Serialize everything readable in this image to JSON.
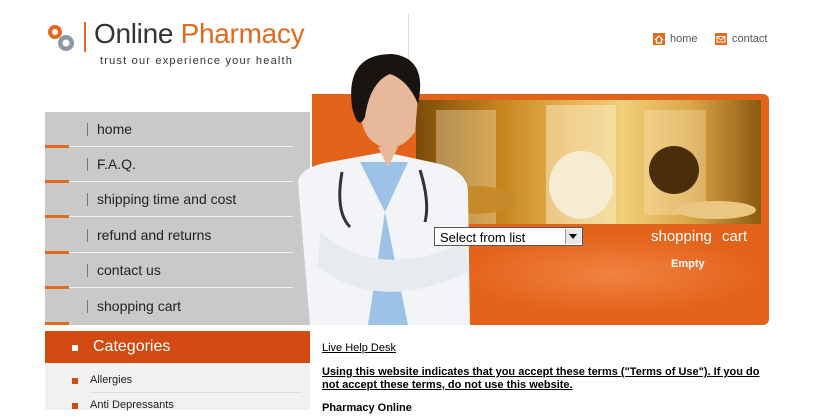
{
  "logo": {
    "word1": "Online",
    "word2": "Pharmacy",
    "tagline": "trust our experience your health"
  },
  "top_links": [
    {
      "label": "home",
      "icon": "home-icon"
    },
    {
      "label": "contact",
      "icon": "envelope-icon"
    }
  ],
  "menu": {
    "items": [
      {
        "label": "home"
      },
      {
        "label": "F.A.Q."
      },
      {
        "label": "shipping time and cost"
      },
      {
        "label": "refund and returns"
      },
      {
        "label": "contact us"
      },
      {
        "label": "shopping cart"
      }
    ]
  },
  "cart": {
    "select_value": "Select from list",
    "title": "shopping cart",
    "status": "Empty"
  },
  "categories": {
    "title": "Categories",
    "items": [
      {
        "label": "Allergies"
      },
      {
        "label": "Anti Depressants"
      }
    ]
  },
  "content": {
    "help_link": "Live Help Desk",
    "terms": "Using this website indicates that you accept these terms (\"Terms of Use\"). If you do not accept these terms, do not use this website.",
    "heading": "Pharmacy Online"
  },
  "colors": {
    "accent": "#e06a1f",
    "banner": "#e4631b",
    "category_header": "#d24a12",
    "menu_bg": "#c9c9c9"
  }
}
